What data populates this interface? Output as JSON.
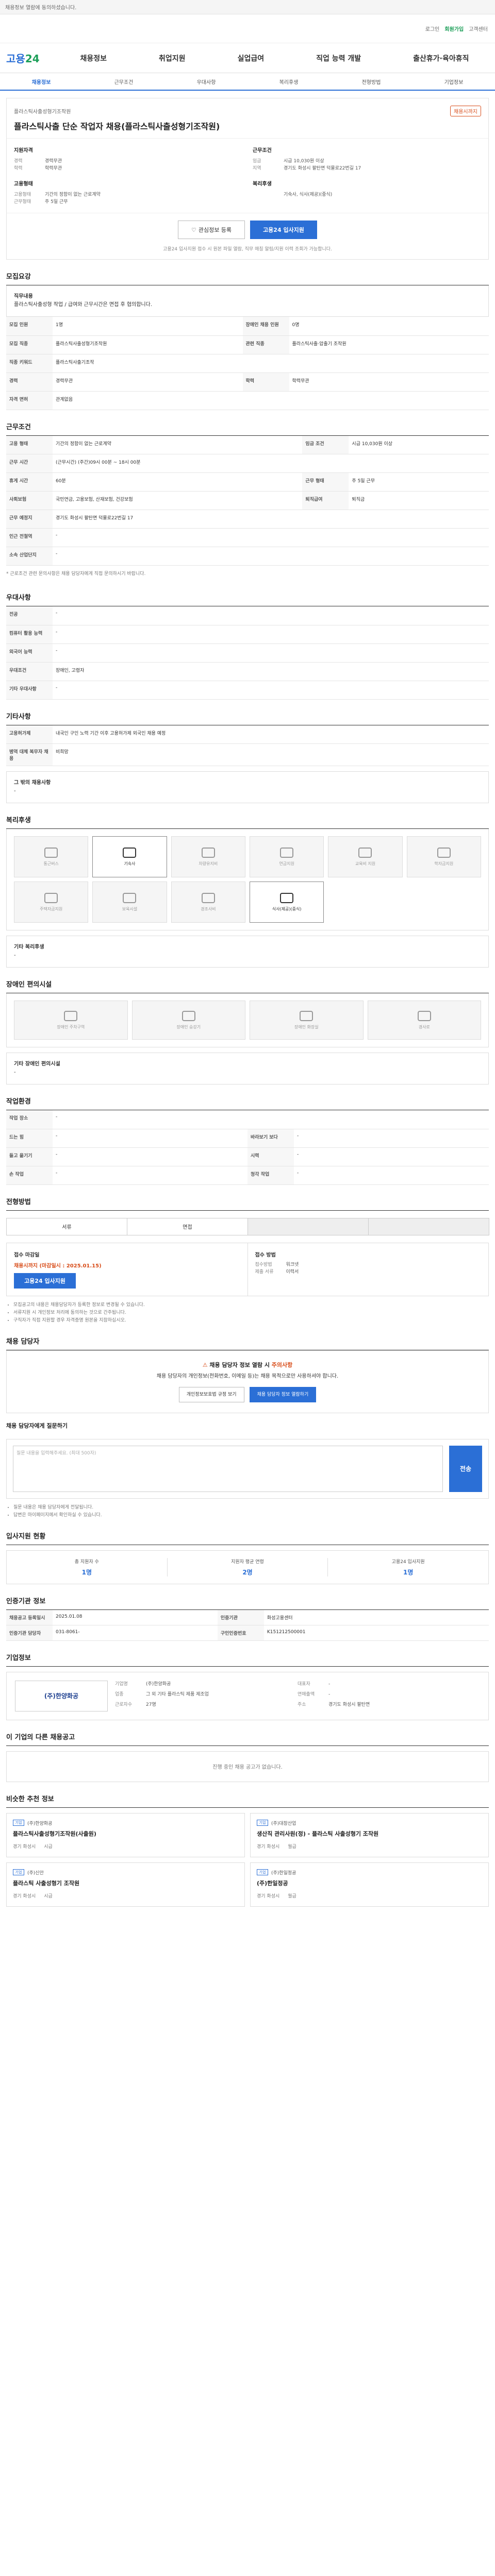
{
  "top_notice": "채용정보 열람에 동의하셨습니다.",
  "header": {
    "links": [
      "로그인",
      "회원가입",
      "고객센터"
    ],
    "logo_a": "고용",
    "logo_b": "24",
    "gnb": [
      "채용정보",
      "취업지원",
      "실업급여",
      "직업 능력 개발",
      "출산휴가·육아휴직"
    ],
    "subnav": [
      "채용정보",
      "근무조건",
      "우대사항",
      "복리후생",
      "전형방법",
      "기업정보"
    ]
  },
  "job": {
    "company": "플라스틱사출성형기조작원",
    "badge": "채용시까지",
    "title": "플라스틱사출 단순 작업자 채용(플라스틱사출성형기조작원)",
    "left_title": "지원자격",
    "left": [
      {
        "k": "경력",
        "v": "경력무관"
      },
      {
        "k": "학력",
        "v": "학력무관"
      }
    ],
    "left2_title": "고용형태",
    "left2": [
      {
        "k": "고용형태",
        "v": "기간의 정함이 없는 근로계약"
      },
      {
        "k": "근무형태",
        "v": "주 5일 근무"
      }
    ],
    "right_title": "근무조건",
    "right": [
      {
        "k": "임금",
        "v": "시급 10,030원 이상"
      },
      {
        "k": "지역",
        "v": "경기도 화성시 팔탄면 덕물로22번길 17"
      }
    ],
    "right2_title": "복리후생",
    "right2": [
      {
        "k": "",
        "v": "기숙사, 식사(제공)(중식)"
      }
    ],
    "btn_scrap": "관심정보 등록",
    "btn_apply": "고용24 입사지원",
    "apply_note": "고용24 입사지원 접수 시 원본 파일 열람, 직무 매칭 알림/지원 이력 조회가 가능합니다."
  },
  "job_content": {
    "title": "모집요강",
    "label": "직무내용",
    "text": "플라스틱사출성형 작업 / 급여와 근무시간은 면접 후 협의합니다."
  },
  "recruit_table": [
    {
      "k": "모집 인원",
      "v": "1명",
      "k2": "장애인 채용 인원",
      "v2": "0명"
    },
    {
      "k": "모집 직종",
      "v": "플라스틱사출성형기조작원",
      "k2": "관련 직종",
      "v2": "플라스틱사출·압출기 조작원"
    },
    {
      "k": "직종 키워드",
      "v": "플라스틱사출기조작",
      "k2": "",
      "v2": ""
    },
    {
      "k": "경력",
      "v": "경력무관",
      "k2": "학력",
      "v2": "학력무관"
    },
    {
      "k": "자격 면허",
      "v": "관계없음",
      "k2": "",
      "v2": ""
    }
  ],
  "work_title": "근무조건",
  "work_table": [
    {
      "k": "고용 형태",
      "v": "기간의 정함이 없는 근로계약",
      "k2": "임금 조건",
      "v2": "시급 10,030원 이상"
    },
    {
      "k": "근무 시간",
      "v": "(근무시간) (주간)09시 00분 ~ 18시 00분",
      "k2": "",
      "v2": ""
    },
    {
      "k": "휴게 시간",
      "v": "60분",
      "k2": "근무 형태",
      "v2": "주 5일 근무"
    },
    {
      "k": "사회보험",
      "v": "국민연금, 고용보험, 산재보험, 건강보험",
      "k2": "퇴직급여",
      "v2": "퇴직금"
    },
    {
      "k": "근무 예정지",
      "v": "경기도 화성시 팔탄면 덕물로22번길 17",
      "k2": "",
      "v2": ""
    },
    {
      "k": "인근 전철역",
      "v": "-",
      "k2": "",
      "v2": ""
    },
    {
      "k": "소속 산업단지",
      "v": "-",
      "k2": "",
      "v2": ""
    }
  ],
  "work_note": "* 근로조건 관련 문의사항은 채용 담당자에게 직접 문의하시기 바랍니다.",
  "pref_title": "우대사항",
  "pref_table": [
    {
      "k": "전공",
      "v": "-"
    },
    {
      "k": "컴퓨터 활용 능력",
      "v": "-"
    },
    {
      "k": "외국어 능력",
      "v": "-"
    },
    {
      "k": "우대조건",
      "v": "장애인, 고령자"
    },
    {
      "k": "기타 우대사항",
      "v": "-"
    }
  ],
  "etc_title": "기타사항",
  "etc_table": [
    {
      "k": "고용허가제",
      "v": "내국인 구인 노력 기간 이후 고용허가제 외국인 채용 예정"
    },
    {
      "k": "병역 대체 복무자 채용",
      "v": "비희망"
    }
  ],
  "etc_other_label": "그 밖의 채용사항",
  "etc_other_value": "-",
  "welfare_title": "복리후생",
  "welfare": [
    {
      "label": "통근버스",
      "on": false
    },
    {
      "label": "기숙사",
      "on": true
    },
    {
      "label": "차량유지비",
      "on": false
    },
    {
      "label": "연금지원",
      "on": false
    },
    {
      "label": "교육비 지원",
      "on": false
    },
    {
      "label": "학자금지원",
      "on": false
    },
    {
      "label": "주택자금지원",
      "on": false
    },
    {
      "label": "보육시설",
      "on": false
    },
    {
      "label": "경조사비",
      "on": false
    },
    {
      "label": "식사(제공)(중식)",
      "on": true
    }
  ],
  "welfare_other_label": "기타 복리후생",
  "welfare_other_value": "-",
  "disab_title": "장애인 편의시설",
  "disab": [
    "장애인 주차구역",
    "장애인 승강기",
    "장애인 화장실",
    "경사로"
  ],
  "disab_other_label": "기타 장애인 편의시설",
  "disab_other_value": "-",
  "env_title": "작업환경",
  "env_table": [
    {
      "k": "작업 장소",
      "v": "-",
      "k2": "",
      "v2": ""
    },
    {
      "k": "드는 힘",
      "v": "-",
      "k2": "바라보기 보다",
      "v2": "-"
    },
    {
      "k": "들고 옮기기",
      "v": "-",
      "k2": "시력",
      "v2": "-"
    },
    {
      "k": "손 작업",
      "v": "-",
      "k2": "청각 작업",
      "v2": "-"
    }
  ],
  "proc_title": "전형방법",
  "proc_steps": [
    {
      "label": "서류",
      "on": true
    },
    {
      "label": "면접",
      "on": true
    },
    {
      "label": "",
      "on": false
    },
    {
      "label": "",
      "on": false
    }
  ],
  "proc_left_title": "접수 마감일",
  "proc_deadline": "채용시까지 (마감일시 : 2025.01.15)",
  "proc_apply": "고용24 입사지원",
  "proc_right_title": "접수 방법",
  "proc_right": [
    {
      "k": "접수방법",
      "v": "워크넷"
    },
    {
      "k": "제출 서류",
      "v": "이력서"
    }
  ],
  "proc_notes": [
    "모집공고의 내용은 채용담당자가 등록한 정보로 변경될 수 있습니다.",
    "서류지원 시 개인정보 처리에 동의하는 것으로 간주됩니다.",
    "구직자가 직접 지원할 경우 자격증명 원본을 지참하십시오."
  ],
  "contact_title": "채용 담당자",
  "contact_warn_title_a": "채용 담당자 정보 열람 시 ",
  "contact_warn_title_b": "주의사항",
  "contact_warn_text": "채용 담당자의 개인정보(전화번호, 이메일 등)는 채용 목적으로만 사용하셔야 합니다.",
  "contact_btn1": "개인정보보호법 규정 보기",
  "contact_btn2": "채용 담당자 정보 열람하기",
  "qna_title": "채용 담당자에게 질문하기",
  "qna_placeholder": "질문 내용을 입력해주세요. (최대 500자)",
  "qna_send": "전송",
  "qna_notes": [
    "질문 내용은 채용 담당자에게 전달됩니다.",
    "답변은 마이페이지에서 확인하실 수 있습니다."
  ],
  "stats_title": "입사지원 현황",
  "stats": [
    {
      "label": "총 지원자 수",
      "value": "1명"
    },
    {
      "label": "지원자 평균 연령",
      "value": "2명"
    },
    {
      "label": "고용24 입사지원",
      "value": "1명"
    }
  ],
  "info_title": "인증기관 정보",
  "info_table": [
    {
      "k": "채용공고 등록일시",
      "v": "2025.01.08",
      "k2": "인증기관",
      "v2": "화성고용센터"
    },
    {
      "k": "인증기관 담당자",
      "v": "031-8061-",
      "k2": "구인인증번호",
      "v2": "K151212500001"
    }
  ],
  "company_title": "기업정보",
  "company_logo": "(주)한양화공",
  "company_info": [
    {
      "k": "기업명",
      "v": "(주)한양화공"
    },
    {
      "k": "업종",
      "v": "그 외 기타 플라스틱 제품 제조업"
    },
    {
      "k": "근로자수",
      "v": "27명"
    },
    {
      "k": "대표자",
      "v": "-"
    },
    {
      "k": "연매출액",
      "v": "-"
    },
    {
      "k": "주소",
      "v": "경기도 화성시 팔탄면"
    }
  ],
  "same_title": "이 기업의 다른 채용공고",
  "same_empty": "진행 중인 채용 공고가 없습니다.",
  "rec_title": "비슷한 추천 정보",
  "recs": [
    {
      "company": "(주)한양화공",
      "title": "플라스틱사출성형기조작원(사출원)",
      "place": "경기 화성시",
      "pay": "시급"
    },
    {
      "company": "(주)대창산업",
      "title": "생산직 관리사원(정) - 플라스틱 사출성형기 조작원",
      "place": "경기 화성시",
      "pay": "월급"
    },
    {
      "company": "(주)신안",
      "title": "플라스틱 사출성형기 조작원",
      "place": "경기 화성시",
      "pay": "시급"
    },
    {
      "company": "(주)한일정공",
      "title": "(주)한일정공",
      "place": "경기 화성시",
      "pay": "월급"
    }
  ]
}
